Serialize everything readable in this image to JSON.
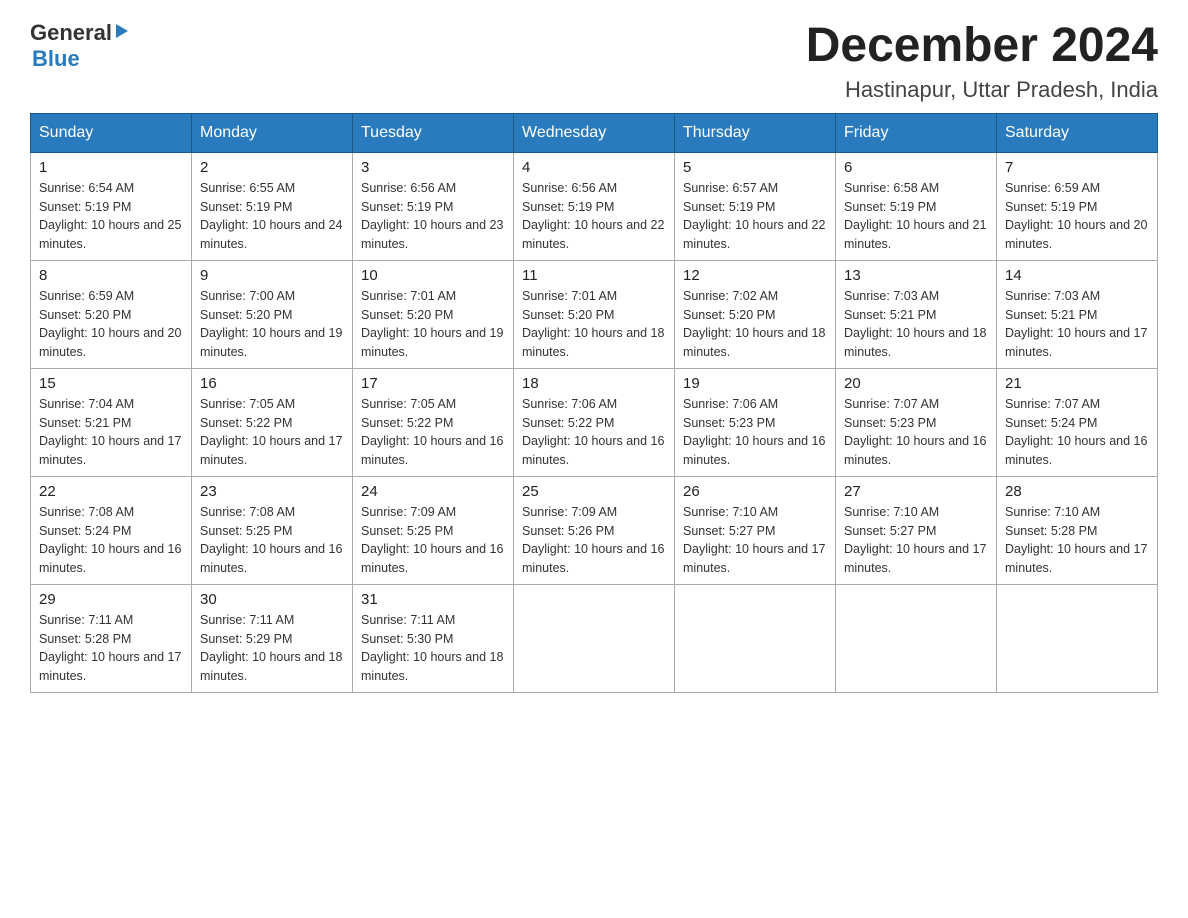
{
  "header": {
    "logo": {
      "general": "General",
      "blue": "Blue"
    },
    "title": "December 2024",
    "location": "Hastinapur, Uttar Pradesh, India"
  },
  "calendar": {
    "days_of_week": [
      "Sunday",
      "Monday",
      "Tuesday",
      "Wednesday",
      "Thursday",
      "Friday",
      "Saturday"
    ],
    "weeks": [
      [
        {
          "day": "1",
          "sunrise": "Sunrise: 6:54 AM",
          "sunset": "Sunset: 5:19 PM",
          "daylight": "Daylight: 10 hours and 25 minutes."
        },
        {
          "day": "2",
          "sunrise": "Sunrise: 6:55 AM",
          "sunset": "Sunset: 5:19 PM",
          "daylight": "Daylight: 10 hours and 24 minutes."
        },
        {
          "day": "3",
          "sunrise": "Sunrise: 6:56 AM",
          "sunset": "Sunset: 5:19 PM",
          "daylight": "Daylight: 10 hours and 23 minutes."
        },
        {
          "day": "4",
          "sunrise": "Sunrise: 6:56 AM",
          "sunset": "Sunset: 5:19 PM",
          "daylight": "Daylight: 10 hours and 22 minutes."
        },
        {
          "day": "5",
          "sunrise": "Sunrise: 6:57 AM",
          "sunset": "Sunset: 5:19 PM",
          "daylight": "Daylight: 10 hours and 22 minutes."
        },
        {
          "day": "6",
          "sunrise": "Sunrise: 6:58 AM",
          "sunset": "Sunset: 5:19 PM",
          "daylight": "Daylight: 10 hours and 21 minutes."
        },
        {
          "day": "7",
          "sunrise": "Sunrise: 6:59 AM",
          "sunset": "Sunset: 5:19 PM",
          "daylight": "Daylight: 10 hours and 20 minutes."
        }
      ],
      [
        {
          "day": "8",
          "sunrise": "Sunrise: 6:59 AM",
          "sunset": "Sunset: 5:20 PM",
          "daylight": "Daylight: 10 hours and 20 minutes."
        },
        {
          "day": "9",
          "sunrise": "Sunrise: 7:00 AM",
          "sunset": "Sunset: 5:20 PM",
          "daylight": "Daylight: 10 hours and 19 minutes."
        },
        {
          "day": "10",
          "sunrise": "Sunrise: 7:01 AM",
          "sunset": "Sunset: 5:20 PM",
          "daylight": "Daylight: 10 hours and 19 minutes."
        },
        {
          "day": "11",
          "sunrise": "Sunrise: 7:01 AM",
          "sunset": "Sunset: 5:20 PM",
          "daylight": "Daylight: 10 hours and 18 minutes."
        },
        {
          "day": "12",
          "sunrise": "Sunrise: 7:02 AM",
          "sunset": "Sunset: 5:20 PM",
          "daylight": "Daylight: 10 hours and 18 minutes."
        },
        {
          "day": "13",
          "sunrise": "Sunrise: 7:03 AM",
          "sunset": "Sunset: 5:21 PM",
          "daylight": "Daylight: 10 hours and 18 minutes."
        },
        {
          "day": "14",
          "sunrise": "Sunrise: 7:03 AM",
          "sunset": "Sunset: 5:21 PM",
          "daylight": "Daylight: 10 hours and 17 minutes."
        }
      ],
      [
        {
          "day": "15",
          "sunrise": "Sunrise: 7:04 AM",
          "sunset": "Sunset: 5:21 PM",
          "daylight": "Daylight: 10 hours and 17 minutes."
        },
        {
          "day": "16",
          "sunrise": "Sunrise: 7:05 AM",
          "sunset": "Sunset: 5:22 PM",
          "daylight": "Daylight: 10 hours and 17 minutes."
        },
        {
          "day": "17",
          "sunrise": "Sunrise: 7:05 AM",
          "sunset": "Sunset: 5:22 PM",
          "daylight": "Daylight: 10 hours and 16 minutes."
        },
        {
          "day": "18",
          "sunrise": "Sunrise: 7:06 AM",
          "sunset": "Sunset: 5:22 PM",
          "daylight": "Daylight: 10 hours and 16 minutes."
        },
        {
          "day": "19",
          "sunrise": "Sunrise: 7:06 AM",
          "sunset": "Sunset: 5:23 PM",
          "daylight": "Daylight: 10 hours and 16 minutes."
        },
        {
          "day": "20",
          "sunrise": "Sunrise: 7:07 AM",
          "sunset": "Sunset: 5:23 PM",
          "daylight": "Daylight: 10 hours and 16 minutes."
        },
        {
          "day": "21",
          "sunrise": "Sunrise: 7:07 AM",
          "sunset": "Sunset: 5:24 PM",
          "daylight": "Daylight: 10 hours and 16 minutes."
        }
      ],
      [
        {
          "day": "22",
          "sunrise": "Sunrise: 7:08 AM",
          "sunset": "Sunset: 5:24 PM",
          "daylight": "Daylight: 10 hours and 16 minutes."
        },
        {
          "day": "23",
          "sunrise": "Sunrise: 7:08 AM",
          "sunset": "Sunset: 5:25 PM",
          "daylight": "Daylight: 10 hours and 16 minutes."
        },
        {
          "day": "24",
          "sunrise": "Sunrise: 7:09 AM",
          "sunset": "Sunset: 5:25 PM",
          "daylight": "Daylight: 10 hours and 16 minutes."
        },
        {
          "day": "25",
          "sunrise": "Sunrise: 7:09 AM",
          "sunset": "Sunset: 5:26 PM",
          "daylight": "Daylight: 10 hours and 16 minutes."
        },
        {
          "day": "26",
          "sunrise": "Sunrise: 7:10 AM",
          "sunset": "Sunset: 5:27 PM",
          "daylight": "Daylight: 10 hours and 17 minutes."
        },
        {
          "day": "27",
          "sunrise": "Sunrise: 7:10 AM",
          "sunset": "Sunset: 5:27 PM",
          "daylight": "Daylight: 10 hours and 17 minutes."
        },
        {
          "day": "28",
          "sunrise": "Sunrise: 7:10 AM",
          "sunset": "Sunset: 5:28 PM",
          "daylight": "Daylight: 10 hours and 17 minutes."
        }
      ],
      [
        {
          "day": "29",
          "sunrise": "Sunrise: 7:11 AM",
          "sunset": "Sunset: 5:28 PM",
          "daylight": "Daylight: 10 hours and 17 minutes."
        },
        {
          "day": "30",
          "sunrise": "Sunrise: 7:11 AM",
          "sunset": "Sunset: 5:29 PM",
          "daylight": "Daylight: 10 hours and 18 minutes."
        },
        {
          "day": "31",
          "sunrise": "Sunrise: 7:11 AM",
          "sunset": "Sunset: 5:30 PM",
          "daylight": "Daylight: 10 hours and 18 minutes."
        },
        null,
        null,
        null,
        null
      ]
    ]
  }
}
